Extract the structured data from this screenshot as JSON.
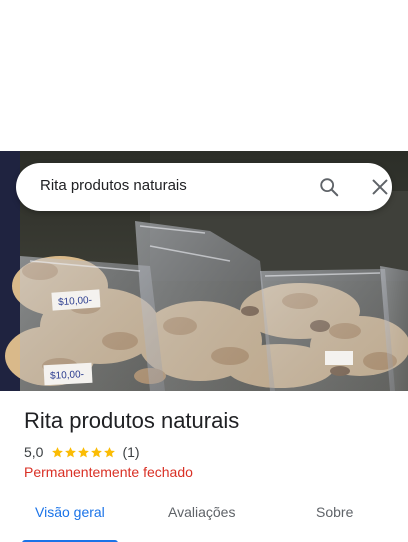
{
  "search": {
    "query": "Rita produtos naturais"
  },
  "icons": {
    "search": "search-icon",
    "close": "close-icon"
  },
  "photo": {
    "price_tags": [
      "$10,00-",
      "$10,00-"
    ]
  },
  "place": {
    "name": "Rita produtos naturais",
    "rating": "5,0",
    "stars": 5,
    "review_count": "(1)",
    "status": "Permanentemente fechado"
  },
  "tabs": [
    {
      "label": "Visão geral",
      "active": true
    },
    {
      "label": "Avaliações",
      "active": false
    },
    {
      "label": "Sobre",
      "active": false
    }
  ],
  "colors": {
    "accent": "#1a73e8",
    "star": "#fbbc04",
    "closed_status": "#d93025"
  }
}
